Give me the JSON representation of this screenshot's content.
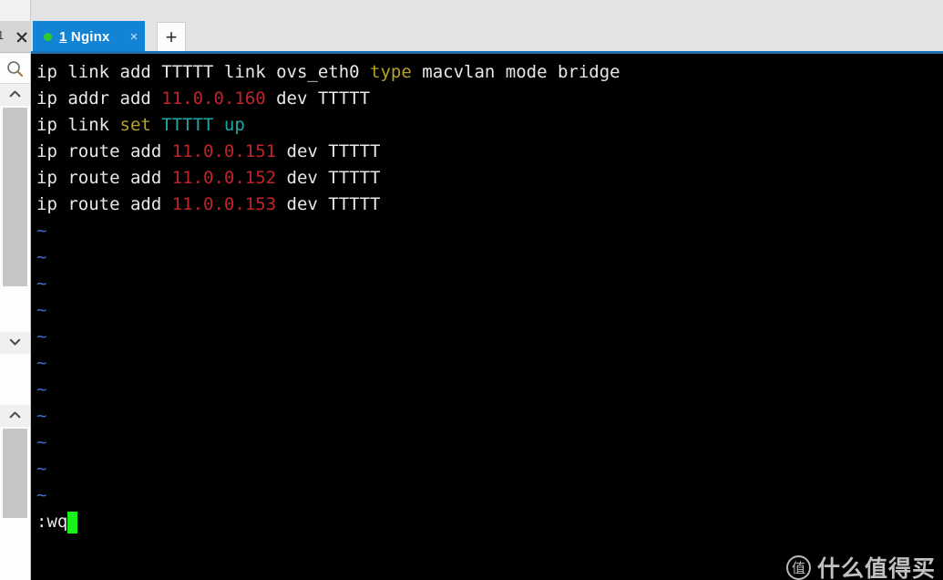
{
  "window": {
    "background_color": "#e3e3e3",
    "accent_color": "#1383d6",
    "underline_color": "#1f6fb5"
  },
  "left_rail": {
    "tab_stub_label": "1",
    "close_icon": "close-icon",
    "search_icon": "search-icon",
    "scroll_up_icon": "chevron-up-icon",
    "scroll_down_icon": "chevron-down-icon"
  },
  "tabbar": {
    "active_tab": {
      "status_dot_color": "#2ecb2e",
      "number": "1",
      "title": " Nginx",
      "close_label": "×"
    },
    "new_tab_label": "+"
  },
  "terminal": {
    "background_color": "#000000",
    "lines": [
      {
        "id": "line-1",
        "segments": [
          {
            "text": "ip link add TTTTT link ovs_eth0 ",
            "color": "white"
          },
          {
            "text": "type",
            "color": "yellow"
          },
          {
            "text": " macvlan mode bridge",
            "color": "white"
          }
        ]
      },
      {
        "id": "line-2",
        "segments": [
          {
            "text": "ip addr add ",
            "color": "white"
          },
          {
            "text": "11.0.0.160",
            "color": "red"
          },
          {
            "text": " dev TTTTT",
            "color": "white"
          }
        ]
      },
      {
        "id": "line-3",
        "segments": [
          {
            "text": "ip link ",
            "color": "white"
          },
          {
            "text": "set",
            "color": "yellow"
          },
          {
            "text": " ",
            "color": "white"
          },
          {
            "text": "TTTTT up",
            "color": "teal"
          }
        ]
      },
      {
        "id": "line-4",
        "segments": [
          {
            "text": "ip route add ",
            "color": "white"
          },
          {
            "text": "11.0.0.151",
            "color": "red"
          },
          {
            "text": " dev TTTTT",
            "color": "white"
          }
        ]
      },
      {
        "id": "line-5",
        "segments": [
          {
            "text": "ip route add ",
            "color": "white"
          },
          {
            "text": "11.0.0.152",
            "color": "red"
          },
          {
            "text": " dev TTTTT",
            "color": "white"
          }
        ]
      },
      {
        "id": "line-6",
        "segments": [
          {
            "text": "ip route add ",
            "color": "white"
          },
          {
            "text": "11.0.0.153",
            "color": "red"
          },
          {
            "text": " dev TTTTT",
            "color": "white"
          }
        ]
      }
    ],
    "empty_line_marker": "~",
    "empty_line_count": 11,
    "empty_line_color": "#3b6fd4",
    "status_line": ":wq",
    "cursor_color": "#1bf01b",
    "colors": {
      "white": "#e8e8e8",
      "red": "#c0232b",
      "yellow": "#b5a227",
      "teal": "#23a6a6"
    }
  },
  "watermark": {
    "logo_text": "值",
    "text": "什么值得买"
  }
}
